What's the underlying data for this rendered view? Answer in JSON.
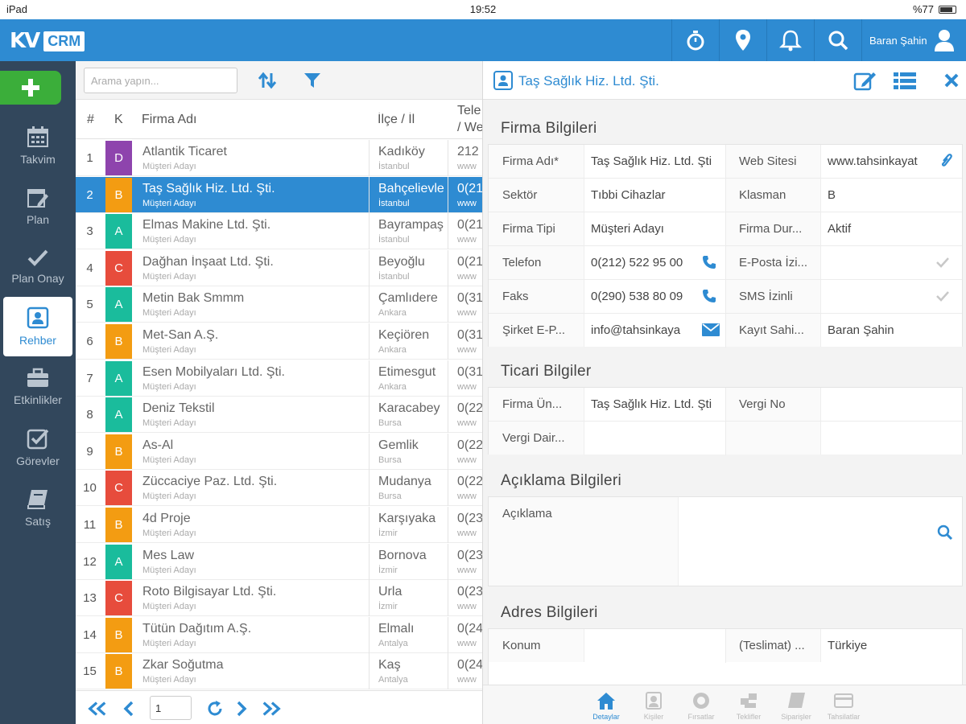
{
  "status_bar": {
    "device": "iPad",
    "time": "19:52",
    "battery": "%77"
  },
  "header": {
    "logo_mark": "KV",
    "logo_text": "CRM",
    "user_name": "Baran Şahin",
    "icons": [
      "stopwatch-icon",
      "location-pin-icon",
      "bell-icon",
      "search-icon",
      "user-icon"
    ]
  },
  "sidebar": {
    "add_label": "+",
    "items": [
      {
        "label": "Takvim",
        "icon": "calendar-icon"
      },
      {
        "label": "Plan",
        "icon": "plan-icon"
      },
      {
        "label": "Plan Onay",
        "icon": "check-icon"
      },
      {
        "label": "Rehber",
        "icon": "contact-card-icon",
        "active": true
      },
      {
        "label": "Etkinlikler",
        "icon": "briefcase-icon"
      },
      {
        "label": "Görevler",
        "icon": "task-check-icon"
      },
      {
        "label": "Satış",
        "icon": "book-icon"
      }
    ]
  },
  "list": {
    "search_placeholder": "Arama yapın...",
    "columns": {
      "num": "#",
      "k": "K",
      "name": "Firma Adı",
      "location": "İlçe / İl",
      "tel_line1": "Tele",
      "tel_line2": "/ We"
    },
    "rows": [
      {
        "num": "1",
        "k": "D",
        "color": "#8e44ad",
        "name": "Atlantik Ticaret",
        "sub": "Müşteri Adayı",
        "ilce": "Kadıköy",
        "il": "İstanbul",
        "tel": "212",
        "web": "www"
      },
      {
        "num": "2",
        "k": "B",
        "color": "#f39c12",
        "name": "Taş Sağlık Hiz. Ltd. Şti.",
        "sub": "Müşteri Adayı",
        "ilce": "Bahçelievle",
        "il": "İstanbul",
        "tel": "0(21",
        "web": "www",
        "selected": true
      },
      {
        "num": "3",
        "k": "A",
        "color": "#1abc9c",
        "name": "Elmas Makine Ltd. Şti.",
        "sub": "Müşteri Adayı",
        "ilce": "Bayrampaş",
        "il": "İstanbul",
        "tel": "0(21",
        "web": "www"
      },
      {
        "num": "4",
        "k": "C",
        "color": "#e74c3c",
        "name": "Dağhan İnşaat Ltd. Şti.",
        "sub": "Müşteri Adayı",
        "ilce": "Beyoğlu",
        "il": "İstanbul",
        "tel": "0(21",
        "web": "www"
      },
      {
        "num": "5",
        "k": "A",
        "color": "#1abc9c",
        "name": "Metin Bak Smmm",
        "sub": "Müşteri Adayı",
        "ilce": "Çamlıdere",
        "il": "Ankara",
        "tel": "0(31",
        "web": "www"
      },
      {
        "num": "6",
        "k": "B",
        "color": "#f39c12",
        "name": "Met-San A.Ş.",
        "sub": "Müşteri Adayı",
        "ilce": "Keçiören",
        "il": "Ankara",
        "tel": "0(31",
        "web": "www"
      },
      {
        "num": "7",
        "k": "A",
        "color": "#1abc9c",
        "name": "Esen Mobilyaları Ltd. Şti.",
        "sub": "Müşteri Adayı",
        "ilce": "Etimesgut",
        "il": "Ankara",
        "tel": "0(31",
        "web": "www"
      },
      {
        "num": "8",
        "k": "A",
        "color": "#1abc9c",
        "name": "Deniz Tekstil",
        "sub": "Müşteri Adayı",
        "ilce": "Karacabey",
        "il": "Bursa",
        "tel": "0(22",
        "web": "www"
      },
      {
        "num": "9",
        "k": "B",
        "color": "#f39c12",
        "name": "As-Al",
        "sub": "Müşteri Adayı",
        "ilce": "Gemlik",
        "il": "Bursa",
        "tel": "0(22",
        "web": "www"
      },
      {
        "num": "10",
        "k": "C",
        "color": "#e74c3c",
        "name": "Züccaciye Paz. Ltd. Şti.",
        "sub": "Müşteri Adayı",
        "ilce": "Mudanya",
        "il": "Bursa",
        "tel": "0(22",
        "web": "www"
      },
      {
        "num": "11",
        "k": "B",
        "color": "#f39c12",
        "name": "4d Proje",
        "sub": "Müşteri Adayı",
        "ilce": "Karşıyaka",
        "il": "İzmir",
        "tel": "0(23",
        "web": "www"
      },
      {
        "num": "12",
        "k": "A",
        "color": "#1abc9c",
        "name": "Mes Law",
        "sub": "Müşteri Adayı",
        "ilce": "Bornova",
        "il": "İzmir",
        "tel": "0(23",
        "web": "www"
      },
      {
        "num": "13",
        "k": "C",
        "color": "#e74c3c",
        "name": "Roto Bilgisayar Ltd. Şti.",
        "sub": "Müşteri Adayı",
        "ilce": "Urla",
        "il": "İzmir",
        "tel": "0(23",
        "web": "www"
      },
      {
        "num": "14",
        "k": "B",
        "color": "#f39c12",
        "name": "Tütün Dağıtım A.Ş.",
        "sub": "Müşteri Adayı",
        "ilce": "Elmalı",
        "il": "Antalya",
        "tel": "0(24",
        "web": "www"
      },
      {
        "num": "15",
        "k": "B",
        "color": "#f39c12",
        "name": "Zkar Soğutma",
        "sub": "Müşteri Adayı",
        "ilce": "Kaş",
        "il": "Antalya",
        "tel": "0(24",
        "web": "www"
      }
    ],
    "pager": {
      "page": "1"
    }
  },
  "detail": {
    "title": "Taş Sağlık Hiz. Ltd. Şti.",
    "sections": {
      "firma": {
        "title": "Firma Bilgileri",
        "rows": [
          {
            "l1": "Firma Adı*",
            "v1": "Taş Sağlık Hiz. Ltd. Şti",
            "l2": "Web Sitesi",
            "v2": "www.tahsinkayat"
          },
          {
            "l1": "Sektör",
            "v1": "Tıbbi Cihazlar",
            "l2": "Klasman",
            "v2": "B"
          },
          {
            "l1": "Firma Tipi",
            "v1": "Müşteri Adayı",
            "l2": "Firma Dur...",
            "v2": "Aktif"
          },
          {
            "l1": "Telefon",
            "v1": "0(212) 522 95 00",
            "l2": "E-Posta İzi...",
            "v2": ""
          },
          {
            "l1": "Faks",
            "v1": "0(290) 538 80 09",
            "l2": "SMS İzinli",
            "v2": ""
          },
          {
            "l1": "Şirket E-P...",
            "v1": "info@tahsinkaya",
            "l2": "Kayıt Sahi...",
            "v2": "Baran Şahin"
          }
        ]
      },
      "ticari": {
        "title": "Ticari Bilgiler",
        "rows": [
          {
            "l1": "Firma Ün...",
            "v1": "Taş Sağlık Hiz. Ltd. Şti",
            "l2": "Vergi No",
            "v2": ""
          },
          {
            "l1": "Vergi Dair...",
            "v1": "",
            "l2": "",
            "v2": ""
          }
        ]
      },
      "aciklama": {
        "title": "Açıklama Bilgileri",
        "label": "Açıklama"
      },
      "adres": {
        "title": "Adres Bilgileri",
        "rows": [
          {
            "l1": "Konum",
            "v1": "",
            "l2": "(Teslimat) ...",
            "v2": "Türkiye"
          }
        ]
      }
    },
    "bottom_tabs": [
      {
        "label": "Detaylar",
        "icon": "home-icon",
        "active": true
      },
      {
        "label": "Kişiler",
        "icon": "contacts-icon"
      },
      {
        "label": "Fırsatlar",
        "icon": "opportunity-icon"
      },
      {
        "label": "Teklifler",
        "icon": "offers-icon"
      },
      {
        "label": "Siparişler",
        "icon": "orders-icon"
      },
      {
        "label": "Tahsilatlar",
        "icon": "payments-icon"
      }
    ]
  },
  "colors": {
    "brand": "#2e8bd2",
    "sidebar": "#32475c",
    "add": "#3bae3a"
  }
}
